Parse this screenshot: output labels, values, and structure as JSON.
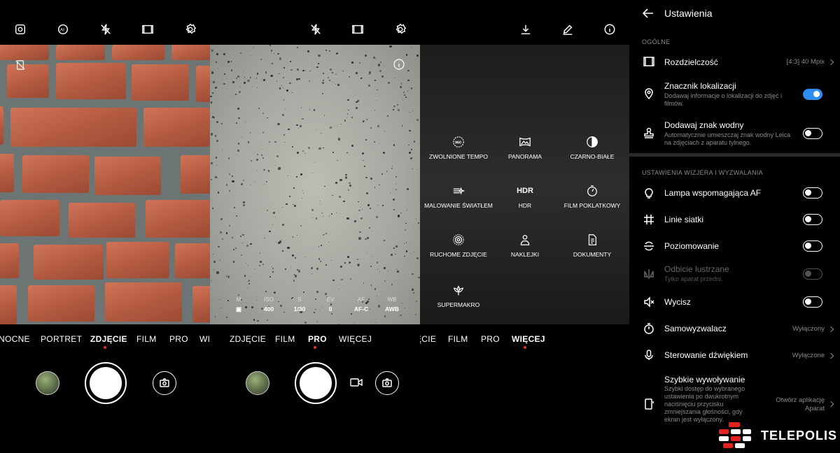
{
  "panel1": {
    "top_icons": [
      "camera-focus-icon",
      "ai-icon",
      "flash-off-icon",
      "aspect-ratio-icon",
      "settings-icon"
    ],
    "modes": [
      "NOCNE",
      "PORTRET",
      "ZDJĘCIE",
      "FILM",
      "PRO",
      "WII"
    ],
    "active_mode": "ZDJĘCIE"
  },
  "panel2": {
    "top_icons": [
      "flash-off-icon",
      "aspect-ratio-icon",
      "settings-icon"
    ],
    "params": [
      {
        "k": "M",
        "v": "▣"
      },
      {
        "k": "ISO",
        "v": "400"
      },
      {
        "k": "S",
        "v": "1/30"
      },
      {
        "k": "EV",
        "v": "0"
      },
      {
        "k": "AF",
        "v": "AF-C"
      },
      {
        "k": "WB",
        "v": "AWB"
      }
    ],
    "modes": [
      "ZDJĘCIE",
      "FILM",
      "PRO",
      "WIĘCEJ"
    ],
    "active_mode": "PRO"
  },
  "panel3": {
    "top_icons": [
      "download-icon",
      "edit-icon",
      "info-icon"
    ],
    "grid": [
      {
        "label": "ZWOLNIONE TEMPO",
        "icon": "slowmo-icon"
      },
      {
        "label": "PANORAMA",
        "icon": "panorama-icon"
      },
      {
        "label": "CZARNO-BIAŁE",
        "icon": "bw-icon"
      },
      {
        "label": "MALOWANIE ŚWIATŁEM",
        "icon": "light-paint-icon"
      },
      {
        "label": "HDR",
        "icon": "hdr-icon",
        "icon_text": "HDR"
      },
      {
        "label": "FILM POKLATKOWY",
        "icon": "timelapse-icon"
      },
      {
        "label": "RUCHOME ZDJĘCIE",
        "icon": "moving-picture-icon"
      },
      {
        "label": "NAKLEJKI",
        "icon": "stickers-icon"
      },
      {
        "label": "DOKUMENTY",
        "icon": "documents-icon"
      },
      {
        "label": "SUPERMAKRO",
        "icon": "supermacro-icon"
      }
    ],
    "modes": [
      "ĘCIE",
      "FILM",
      "PRO",
      "WIĘCEJ"
    ],
    "active_mode": "WIĘCEJ"
  },
  "settings": {
    "title": "Ustawienia",
    "section1": "OGÓLNE",
    "rows1": [
      {
        "title": "Rozdzielczość",
        "value": "[4:3] 40 Mpix"
      },
      {
        "title": "Znacznik lokalizacji",
        "sub": "Dodawaj informacje o lokalizacji do zdjęć i filmów.",
        "toggle": "on"
      },
      {
        "title": "Dodawaj znak wodny",
        "sub": "Automatycznie umieszczaj znak wodny Leica na zdjęciach z aparatu tylnego.",
        "toggle": "off"
      }
    ],
    "section2": "USTAWIENIA WIZJERA I WYZWALANIA",
    "rows2": [
      {
        "title": "Lampa wspomagająca AF",
        "toggle": "off"
      },
      {
        "title": "Linie siatki",
        "toggle": "off"
      },
      {
        "title": "Poziomowanie",
        "toggle": "off"
      },
      {
        "title": "Odbicie lustrzane",
        "sub": "Tylko aparat przedni.",
        "toggle": "disabled"
      },
      {
        "title": "Wycisz",
        "toggle": "off"
      },
      {
        "title": "Samowyzwalacz",
        "value": "Wyłączony"
      },
      {
        "title": "Sterowanie dźwiękiem",
        "value": "Wyłączone"
      },
      {
        "title": "Szybkie wywoływanie",
        "sub": "Szybki dostęp do wybranego ustawienia po dwukrotnym naciśnięciu przycisku zmniejszania głośności, gdy ekran jest wyłączony.",
        "value": "Otwórz aplikację Aparat"
      }
    ]
  },
  "watermark": {
    "text": "TELEPOLIS"
  },
  "colors": {
    "toggle_on": "#2f8cf0",
    "active_dot": "#e5302a"
  }
}
